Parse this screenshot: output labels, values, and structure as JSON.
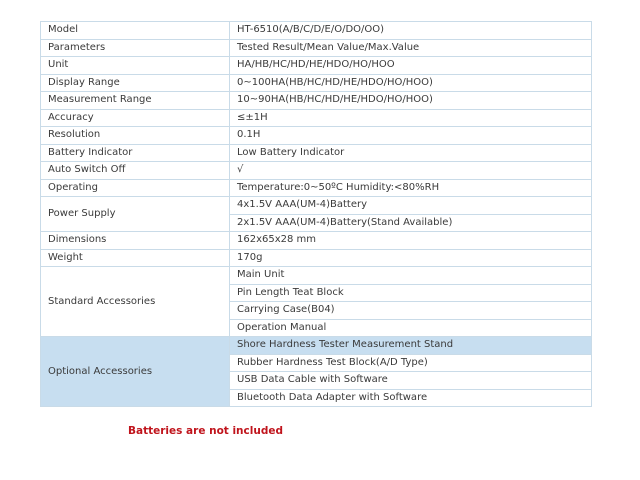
{
  "specs": {
    "rows": [
      {
        "label": "Model",
        "values": [
          "HT-6510(A/B/C/D/E/O/DO/OO)"
        ]
      },
      {
        "label": "Parameters",
        "values": [
          "Tested Result/Mean Value/Max.Value"
        ]
      },
      {
        "label": "Unit",
        "values": [
          "HA/HB/HC/HD/HE/HDO/HO/HOO"
        ]
      },
      {
        "label": "Display Range",
        "values": [
          "0~100HA(HB/HC/HD/HE/HDO/HO/HOO)"
        ]
      },
      {
        "label": "Measurement Range",
        "values": [
          "10~90HA(HB/HC/HD/HE/HDO/HO/HOO)"
        ]
      },
      {
        "label": "Accuracy",
        "values": [
          "≤±1H"
        ]
      },
      {
        "label": "Resolution",
        "values": [
          "0.1H"
        ]
      },
      {
        "label": "Battery Indicator",
        "values": [
          "Low Battery Indicator"
        ]
      },
      {
        "label": "Auto Switch Off",
        "values": [
          "√"
        ]
      },
      {
        "label": "Operating",
        "values": [
          "Temperature:0~50ºC    Humidity:<80%RH"
        ]
      },
      {
        "label": "Power Supply",
        "values": [
          "4x1.5V AAA(UM-4)Battery",
          "2x1.5V AAA(UM-4)Battery(Stand Available)"
        ]
      },
      {
        "label": "Dimensions",
        "values": [
          "162x65x28 mm"
        ]
      },
      {
        "label": "Weight",
        "values": [
          "170g"
        ]
      },
      {
        "label": "Standard Accessories",
        "values": [
          "Main Unit",
          "Pin Length Teat Block",
          "Carrying Case(B04)",
          "Operation Manual"
        ]
      },
      {
        "label": "Optional Accessories",
        "values": [
          "Shore Hardness Tester Measurement Stand",
          "Rubber Hardness Test Block(A/D Type)",
          "USB Data Cable with Software",
          "Bluetooth Data Adapter with Software"
        ]
      }
    ],
    "highlight": {
      "row": 14,
      "label_cell": true,
      "first_value_cell": true,
      "color": "#c7def0"
    },
    "border_color": "#c9dbe8",
    "text_color": "#3a3a3a"
  },
  "note": {
    "text": "Batteries are not included",
    "color": "#c0141c"
  }
}
